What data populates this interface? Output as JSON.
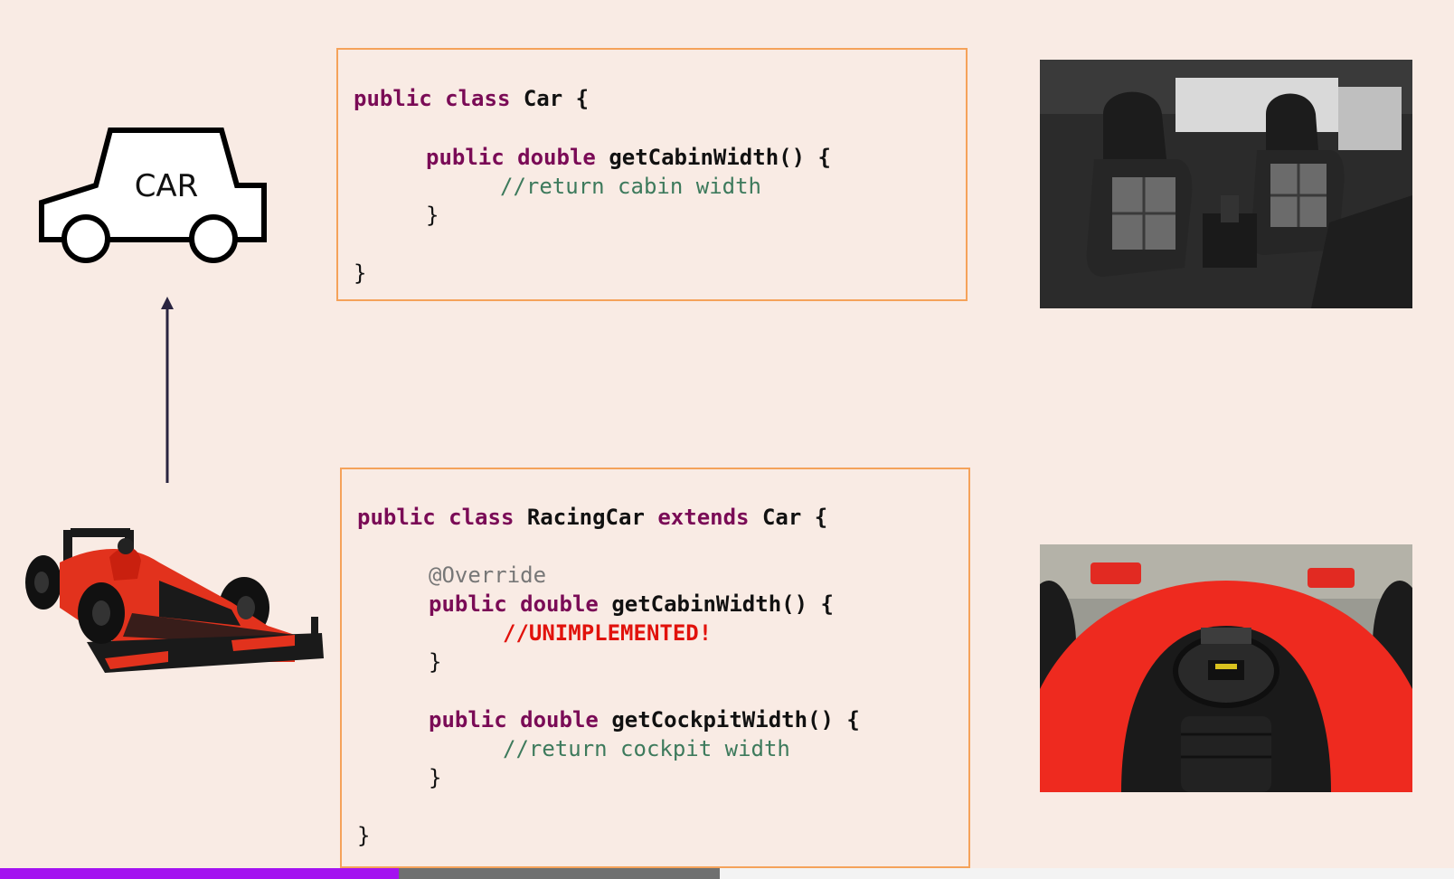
{
  "diagram": {
    "car_label": "CAR"
  },
  "car_class": {
    "l1": [
      "public",
      "class",
      "Car",
      "{"
    ],
    "l2": [
      "public",
      "double",
      "getCabinWidth()",
      "{"
    ],
    "l3": "//return cabin width",
    "l4": "}",
    "l5": "}"
  },
  "racing_class": {
    "l1": [
      "public",
      "class",
      "RacingCar",
      "extends",
      "Car",
      "{"
    ],
    "annotation": "@Override",
    "l2": [
      "public",
      "double",
      "getCabinWidth()",
      "{"
    ],
    "l3": "//UNIMPLEMENTED!",
    "l4": "}",
    "l5": [
      "public",
      "double",
      "getCockpitWidth()",
      "{"
    ],
    "l6": "//return cockpit width",
    "l7": "}",
    "l8": "}"
  },
  "images": {
    "top_right": "car-interior-seats-photo",
    "bottom_right": "racing-cockpit-photo",
    "bottom_left": "formula-one-car-photo"
  },
  "colors": {
    "background": "#f9ebe4",
    "box_border": "#f5a25a",
    "keyword": "#7a0b56",
    "comment": "#3d7a5c",
    "error": "#e1120c",
    "progress_played": "#a412f0",
    "progress_buffered": "#6f7070"
  },
  "player": {
    "progress_fraction": 0.274,
    "buffered_fraction": 0.495
  }
}
